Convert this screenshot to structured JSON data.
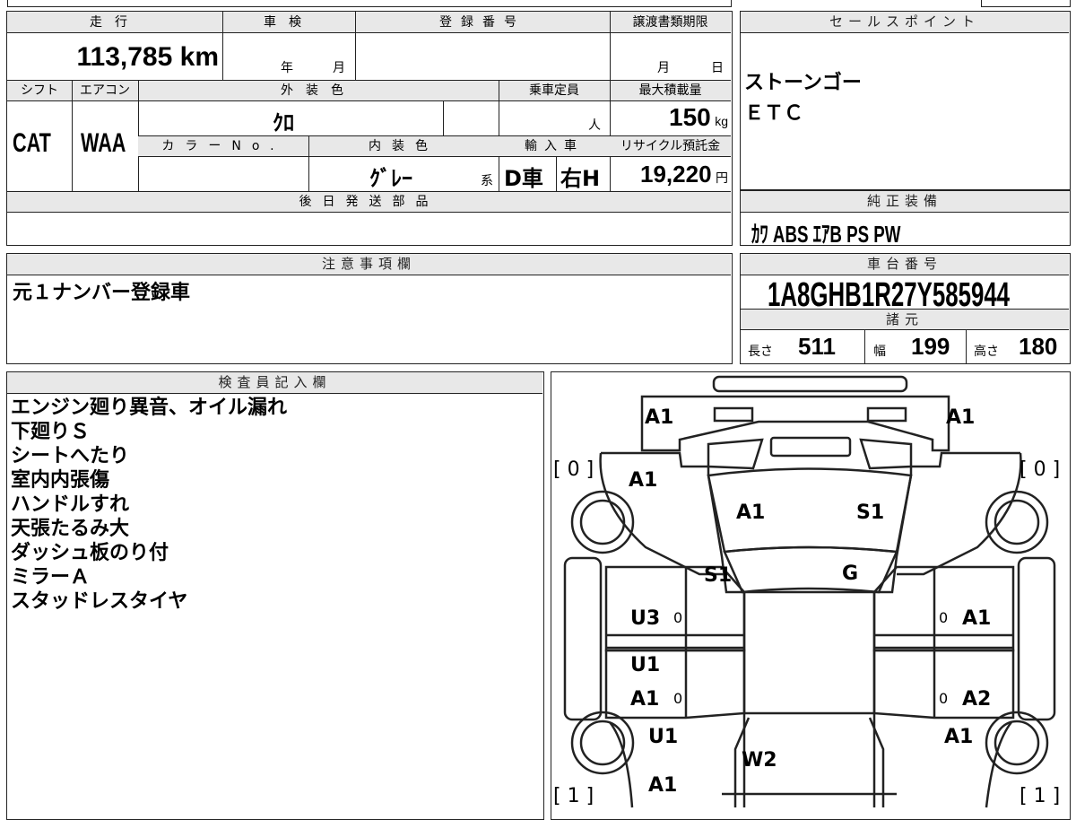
{
  "mileage": {
    "label": "走行",
    "value": "113,785",
    "unit": "km"
  },
  "shaken": {
    "label": "車検",
    "year_unit": "年",
    "month_unit": "月"
  },
  "registration": {
    "label": "登録番号"
  },
  "transfer": {
    "label": "譲渡書類期限",
    "month_unit": "月",
    "day_unit": "日"
  },
  "shift": {
    "label": "シフト",
    "value": "CAT"
  },
  "aircon": {
    "label": "エアコン",
    "value": "WAA"
  },
  "exterior_color": {
    "label": "外装色",
    "value": "ｸﾛ"
  },
  "capacity": {
    "label": "乗車定員",
    "unit": "人"
  },
  "max_load": {
    "label": "最大積載量",
    "value": "150",
    "unit": "kg"
  },
  "color_no": {
    "label": "カラーNo."
  },
  "interior_color": {
    "label": "内装色",
    "value": "ｸﾞﾚｰ",
    "suffix": "系"
  },
  "import": {
    "label": "輸入車",
    "type": "D車",
    "steering": "右H"
  },
  "recycle": {
    "label": "リサイクル預託金",
    "value": "19,220",
    "unit": "円"
  },
  "later_parts": {
    "label": "後日発送部品"
  },
  "sales_point": {
    "label": "セールスポイント",
    "lines": [
      "ストーンゴー",
      "ＥＴＣ"
    ]
  },
  "equipment": {
    "label": "純正装備",
    "value": "ｶﾜ ABS ｴｱB PS PW"
  },
  "notes": {
    "label": "注意事項欄",
    "text": "元１ナンバー登録車"
  },
  "chassis": {
    "label": "車台番号",
    "value": "1A8GHB1R27Y585944"
  },
  "specs": {
    "label": "諸元",
    "length_label": "長さ",
    "length": "511",
    "width_label": "幅",
    "width": "199",
    "height_label": "高さ",
    "height": "180"
  },
  "inspector": {
    "label": "検査員記入欄",
    "lines": [
      "エンジン廻り異音、オイル漏れ",
      "下廻りＳ",
      "シートへたり",
      "室内内張傷",
      "ハンドルすれ",
      "天張たるみ大",
      "ダッシュ板のり付",
      "ミラーＡ",
      "スタッドレスタイヤ"
    ]
  },
  "diagram": {
    "tire_fl": "[ 0 ]",
    "tire_fr": "[ 0 ]",
    "tire_rl": "[ 1 ]",
    "tire_rr": "[ 1 ]",
    "marks": {
      "front_left": "A1",
      "front_right": "A1",
      "fender_left": "A1",
      "hood_left": "A1",
      "hood_right": "S1",
      "windshield_left": "S1",
      "windshield_right": "G",
      "door_fl": "U3",
      "door_fr": "A1",
      "door_rl_a": "U1",
      "door_rl_b": "A1",
      "door_rr": "A2",
      "quarter_left": "U1",
      "quarter_right": "A1",
      "roof_rear": "W2",
      "rear": "A1",
      "zero1": "0",
      "zero2": "0",
      "zero3": "0",
      "zero4": "0"
    }
  }
}
